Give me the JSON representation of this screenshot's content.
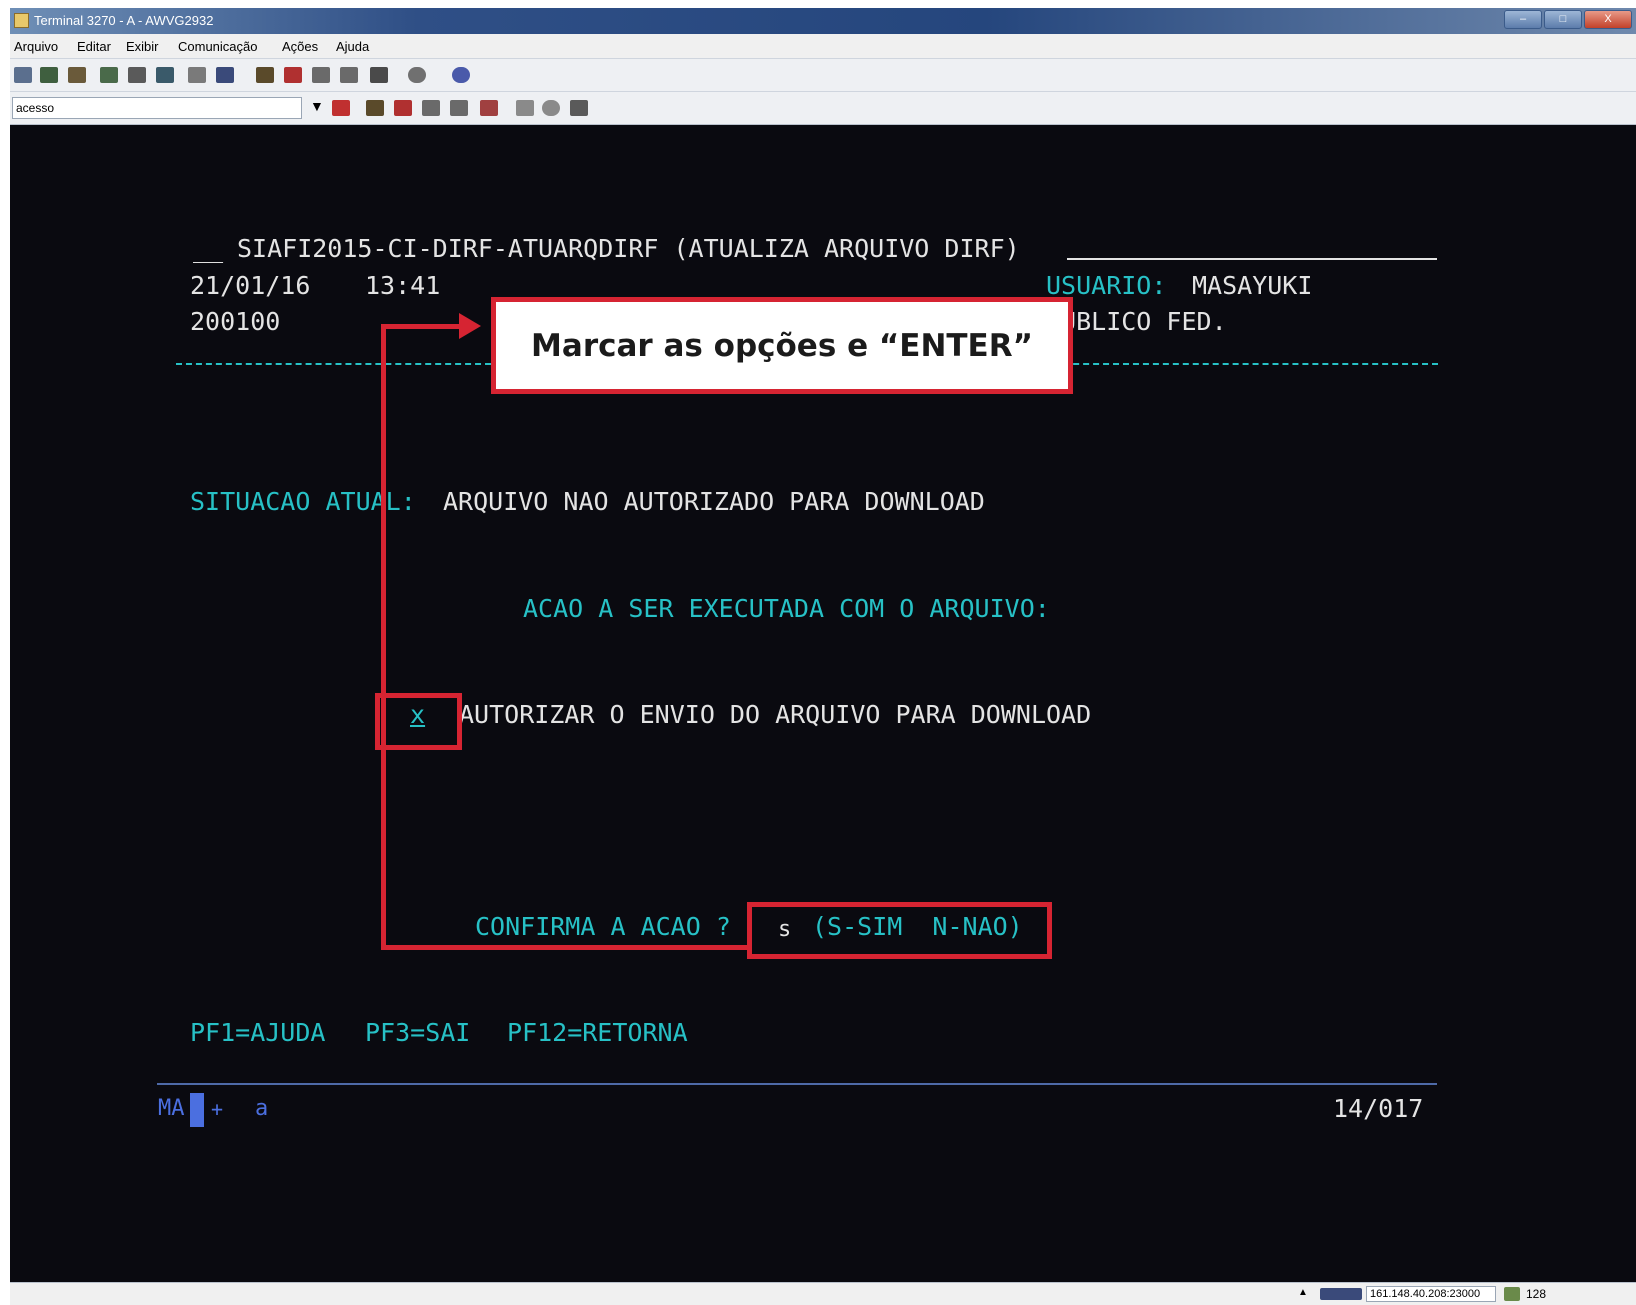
{
  "window": {
    "title": "Terminal 3270 - A - AWVG2932",
    "controls": {
      "minimize": "–",
      "maximize": "□",
      "close": "X"
    }
  },
  "menubar": {
    "items": [
      "Arquivo",
      "Editar",
      "Exibir",
      "Comunicação",
      "Ações",
      "Ajuda"
    ]
  },
  "macro_field": {
    "value": "acesso"
  },
  "screen": {
    "header": "SIAFI2015-CI-DIRF-ATUARQDIRF (ATUALIZA ARQUIVO DIRF)",
    "header_prefix": "__",
    "date": "21/01/16",
    "time": "13:41",
    "code": "200100",
    "usuario_label": "USUARIO:",
    "usuario_value": "MASAYUKI",
    "org": "PUBLICO FED.",
    "situacao_label": "SITUACAO ATUAL:",
    "situacao_value": "ARQUIVO NAO AUTORIZADO PARA DOWNLOAD",
    "acao_title": "ACAO A SER EXECUTADA COM O ARQUIVO:",
    "option_mark": "x",
    "option_label": "AUTORIZAR O ENVIO DO ARQUIVO PARA DOWNLOAD",
    "confirm_label": "CONFIRMA A ACAO ?",
    "confirm_value": "s",
    "confirm_hint": "(S-SIM  N-NAO)",
    "pf_keys": [
      "PF1=AJUDA",
      "PF3=SAI",
      "PF12=RETORNA"
    ]
  },
  "oia": {
    "left": "MA",
    "plus": "+",
    "field": "a",
    "cursor_pos": "14/017"
  },
  "annotation": {
    "callout_text": "Marcar as opções e “ENTER”"
  },
  "statusbar": {
    "host": "161.148.40.208:23000",
    "count": "128"
  },
  "colors": {
    "highlight": "#d62432",
    "terminal_cyan": "#27c1c6",
    "terminal_white": "#e4e4e4",
    "terminal_bg": "#0a0a10"
  }
}
